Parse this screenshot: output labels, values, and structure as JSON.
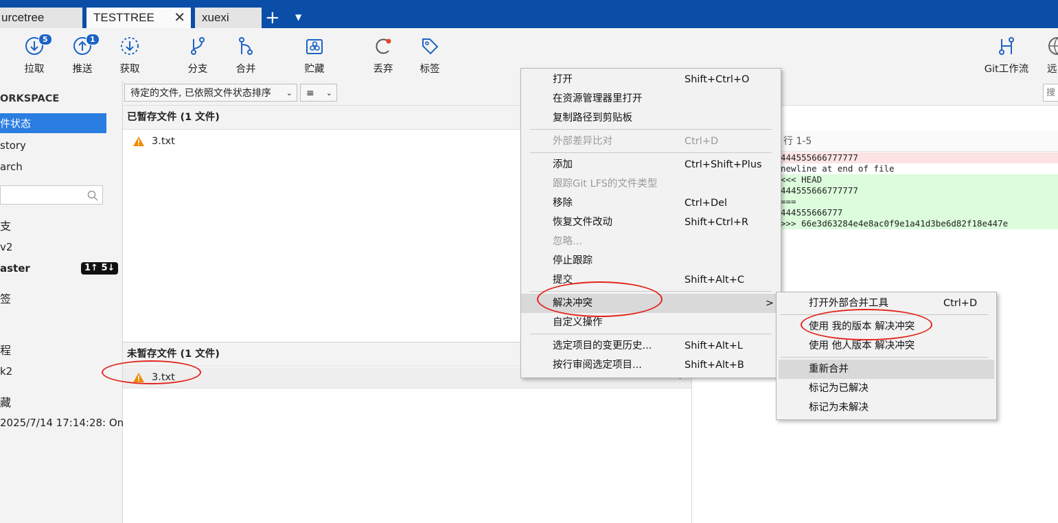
{
  "tabs": [
    {
      "label": "urcetree"
    },
    {
      "label": "TESTTREE",
      "close": "✕"
    },
    {
      "label": "xuexi"
    }
  ],
  "tab_add": "+",
  "tab_menu": "▼",
  "toolbar": {
    "pull": {
      "label": "拉取",
      "badge": "5"
    },
    "push": {
      "label": "推送",
      "badge": "1"
    },
    "fetch": {
      "label": "获取"
    },
    "branch": {
      "label": "分支"
    },
    "merge": {
      "label": "合并"
    },
    "stash": {
      "label": "贮藏"
    },
    "discard": {
      "label": "丢弃"
    },
    "tag": {
      "label": "标签"
    },
    "gitflow": {
      "label": "Git工作流"
    },
    "remote": {
      "label": "远"
    }
  },
  "sidebar": {
    "workspace": "ORKSPACE",
    "items": [
      "件状态",
      "story",
      "arch"
    ],
    "branches_head": "支",
    "branches": [
      "v2",
      "aster"
    ],
    "master_badge": "1↑ 5↓",
    "tags_head": "签",
    "remotes_head": "程",
    "remotes": [
      "k2"
    ],
    "stash_head": "藏",
    "stash_item": "2025/7/14 17:14:28: On"
  },
  "main": {
    "filter_dropdown": "待定的文件, 已依照文件状态排序",
    "view_dropdown": "≡",
    "staged_header": "已暂存文件 (1 文件)",
    "staged_files": [
      "3.txt"
    ],
    "unstaged_header": "未暂存文件 (1 文件)",
    "unstaged_files": [
      "3.txt"
    ],
    "search_placeholder": "搜"
  },
  "diff": {
    "header": "行 1-5",
    "lines": [
      {
        "text": "444555666777777",
        "kind": "del"
      },
      {
        "text": "newline at end of file",
        "kind": "plain"
      },
      {
        "text": "<<< HEAD",
        "kind": "add"
      },
      {
        "text": "444555666777777",
        "kind": "add"
      },
      {
        "text": "===",
        "kind": "add"
      },
      {
        "text": "444555666777",
        "kind": "add"
      },
      {
        "text": ">>> 66e3d63284e4e8ac0f9e1a41d3be6d82f18e447e",
        "kind": "add"
      }
    ]
  },
  "context_menu": [
    {
      "label": "打开",
      "shortcut": "Shift+Ctrl+O"
    },
    {
      "label": "在资源管理器里打开",
      "shortcut": ""
    },
    {
      "label": "复制路径到剪贴板",
      "shortcut": ""
    },
    {
      "label": "外部差异比对",
      "shortcut": "Ctrl+D"
    },
    {
      "label": "添加",
      "shortcut": "Ctrl+Shift+Plus"
    },
    {
      "label": "跟踪Git LFS的文件类型",
      "shortcut": ""
    },
    {
      "label": "移除",
      "shortcut": "Ctrl+Del"
    },
    {
      "label": "恢复文件改动",
      "shortcut": "Shift+Ctrl+R"
    },
    {
      "label": "忽略...",
      "shortcut": ""
    },
    {
      "label": "停止跟踪",
      "shortcut": ""
    },
    {
      "label": "提交",
      "shortcut": "Shift+Alt+C"
    },
    {
      "label": "解决冲突",
      "shortcut": ">"
    },
    {
      "label": "自定义操作",
      "shortcut": ""
    },
    {
      "label": "选定项目的变更历史...",
      "shortcut": "Shift+Alt+L"
    },
    {
      "label": "按行审阅选定项目...",
      "shortcut": "Shift+Alt+B"
    }
  ],
  "submenu": [
    {
      "label": "打开外部合并工具",
      "shortcut": "Ctrl+D"
    },
    {
      "label": "使用 我的版本 解决冲突",
      "shortcut": ""
    },
    {
      "label": "使用 他人版本 解决冲突",
      "shortcut": ""
    },
    {
      "label": "重新合并",
      "shortcut": ""
    },
    {
      "label": "标记为已解决",
      "shortcut": ""
    },
    {
      "label": "标记为未解决",
      "shortcut": ""
    }
  ],
  "colors": {
    "titlebar": "#0a4ea8",
    "selected": "#2a7de1",
    "icon": "#1b63c6",
    "highlight_ring": "#e3241b",
    "diff_add": "#dcfcdc",
    "diff_del": "#fde3e3"
  }
}
